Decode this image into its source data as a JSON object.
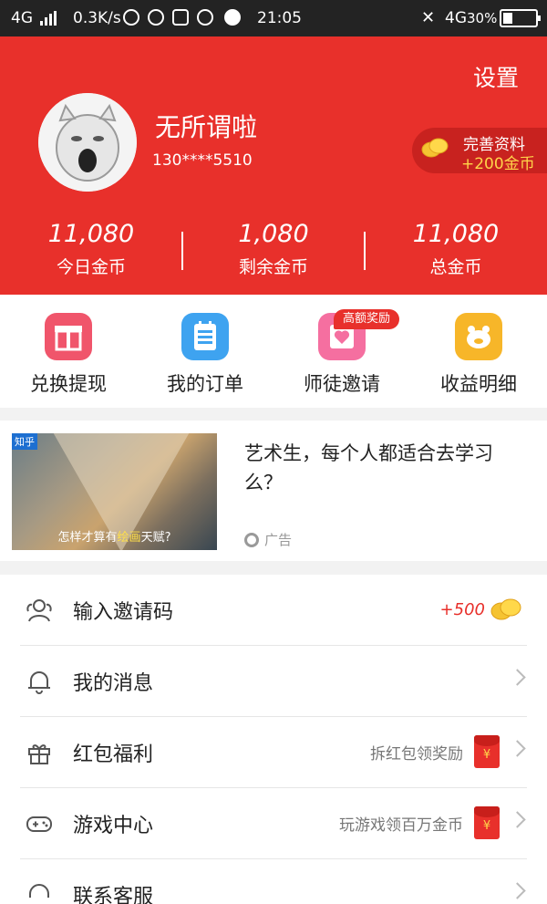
{
  "status_bar": {
    "network_left": "4G",
    "speed": "0.3K/s",
    "time": "21:05",
    "network_right": "4G",
    "battery": "30%"
  },
  "profile": {
    "settings_label": "设置",
    "username": "无所谓啦",
    "phone": "130****5510",
    "complete_badge": {
      "title": "完善资料",
      "bonus": "+200金币"
    },
    "stats": [
      {
        "value": "11,080",
        "label": "今日金币"
      },
      {
        "value": "1,080",
        "label": "剩余金币"
      },
      {
        "value": "11,080",
        "label": "总金币"
      }
    ]
  },
  "quick_actions": [
    {
      "label": "兑换提现",
      "icon": "gift-box-icon",
      "color": "#f0556b"
    },
    {
      "label": "我的订单",
      "icon": "order-list-icon",
      "color": "#3ea3f0"
    },
    {
      "label": "师徒邀请",
      "icon": "invite-heart-icon",
      "color": "#f56fa0",
      "badge": "高额奖励"
    },
    {
      "label": "收益明细",
      "icon": "piggy-bank-icon",
      "color": "#f7b629"
    }
  ],
  "ad": {
    "source_tag": "知乎",
    "caption_prefix": "怎样才算有",
    "caption_highlight": "绘画",
    "caption_suffix": "天赋?",
    "title": "艺术生，每个人都适合去学习么？",
    "tag": "广告"
  },
  "menu": [
    {
      "label": "输入邀请码",
      "icon": "invite-people-icon",
      "right_text": "+500",
      "extra": "coins"
    },
    {
      "label": "我的消息",
      "icon": "bell-icon",
      "right_text": ""
    },
    {
      "label": "红包福利",
      "icon": "gift-icon",
      "right_text": "拆红包领奖励",
      "extra": "red-envelope"
    },
    {
      "label": "游戏中心",
      "icon": "gamepad-icon",
      "right_text": "玩游戏领百万金币",
      "extra": "red-envelope"
    },
    {
      "label": "联系客服",
      "icon": "headset-icon",
      "right_text": ""
    }
  ],
  "colors": {
    "primary_red": "#e8302b",
    "gold": "#ffd44a"
  }
}
